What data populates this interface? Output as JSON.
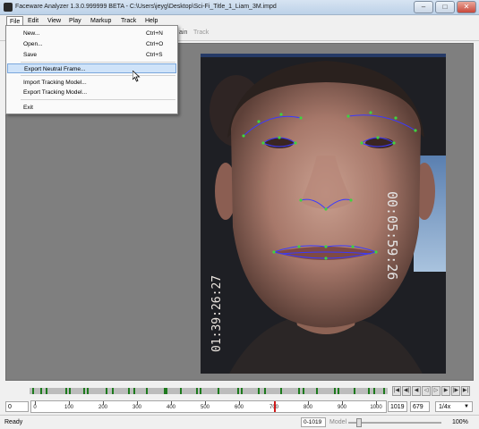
{
  "window": {
    "title": "Faceware Analyzer 1.3.0.999999 BETA - C:\\Users\\jeyg\\Desktop\\Sci-Fi_Title_1_Liam_3M.impd",
    "minimize": "–",
    "maximize": "□",
    "close": "✕"
  },
  "menubar": {
    "items": [
      "File",
      "Edit",
      "View",
      "Play",
      "Markup",
      "Track",
      "Help"
    ]
  },
  "toolbar": {
    "train_label": "ain",
    "track_label": "Track"
  },
  "file_menu": {
    "new": {
      "label": "New...",
      "shortcut": "Ctrl+N"
    },
    "open": {
      "label": "Open...",
      "shortcut": "Ctrl+O"
    },
    "save": {
      "label": "Save",
      "shortcut": "Ctrl+S"
    },
    "export_neutral": {
      "label": "Export Neutral Frame..."
    },
    "import_tracking": {
      "label": "Import Tracking Model..."
    },
    "export_tracking": {
      "label": "Export Tracking Model..."
    },
    "exit": {
      "label": "Exit"
    }
  },
  "video": {
    "timecode_left": "01:39:26:27",
    "timecode_right": "00:05:59:26",
    "landmark_color": "#3fd43f",
    "contour_color": "#3a3aff"
  },
  "timeline": {
    "current_frame": "0",
    "ruler_labels": [
      "0",
      "100",
      "200",
      "300",
      "400",
      "500",
      "600",
      "700",
      "800",
      "900",
      "1000"
    ],
    "end_frame": "1019",
    "frame_count_2": "679",
    "speed": "1/4x",
    "playhead_frame": 700
  },
  "status": {
    "text": "Ready",
    "range": "0-1019",
    "model_label": "Model",
    "zoom": "100%"
  }
}
